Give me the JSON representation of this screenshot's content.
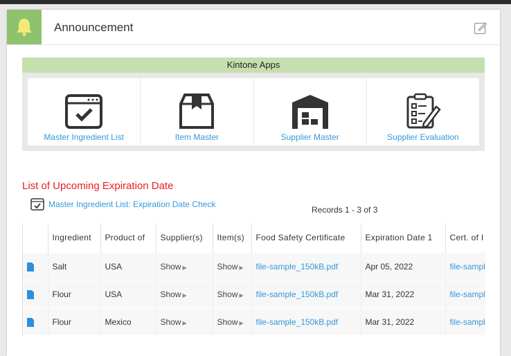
{
  "header": {
    "title": "Announcement"
  },
  "apps": {
    "title": "Kintone Apps",
    "items": [
      {
        "label": "Master Ingredient List",
        "icon": "checklist-window-icon"
      },
      {
        "label": "Item Master",
        "icon": "box-icon"
      },
      {
        "label": "Supplier Master",
        "icon": "warehouse-icon"
      },
      {
        "label": "Supplier Evaluation",
        "icon": "clipboard-pencil-icon"
      }
    ]
  },
  "list": {
    "title": "List of Upcoming Expiration Date",
    "link": "Master Ingredient List: Expiration Date Check",
    "records": "Records 1 - 3  of 3"
  },
  "table": {
    "headers": [
      "",
      "Ingredient",
      "Product of",
      "Supplier(s)",
      "Item(s)",
      "Food Safety Certificate",
      "Expiration Date 1",
      "Cert. of I"
    ],
    "rows": [
      {
        "ingredient": "Salt",
        "product_of": "USA",
        "suppliers": "Show",
        "items": "Show",
        "certificate": "file-sample_150kB.pdf",
        "expiration": "Apr 05, 2022",
        "cert2": "file-sampl"
      },
      {
        "ingredient": "Flour",
        "product_of": "USA",
        "suppliers": "Show",
        "items": "Show",
        "certificate": "file-sample_150kB.pdf",
        "expiration": "Mar 31, 2022",
        "cert2": "file-sampl"
      },
      {
        "ingredient": "Flour",
        "product_of": "Mexico",
        "suppliers": "Show",
        "items": "Show",
        "certificate": "file-sample_150kB.pdf",
        "expiration": "Mar 31, 2022",
        "cert2": "file-sampl"
      }
    ]
  },
  "colors": {
    "accent_green": "#8fc26e",
    "apps_bar": "#c6dfae",
    "link_blue": "#3498db",
    "title_red": "#e5201f"
  }
}
